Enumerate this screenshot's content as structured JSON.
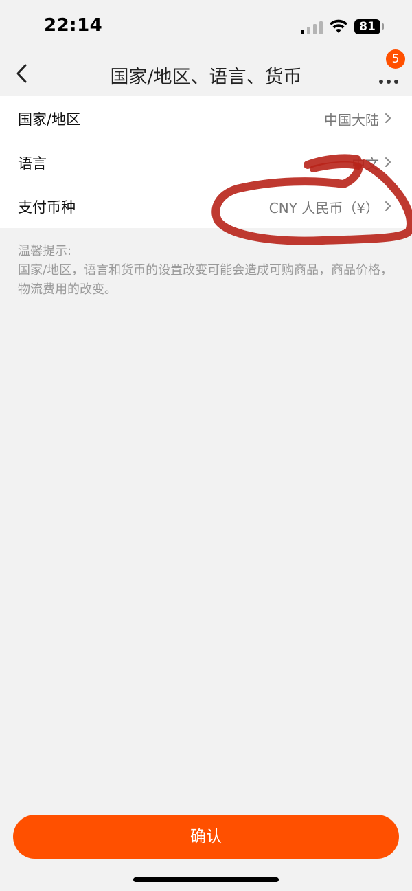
{
  "status_bar": {
    "time": "22:14",
    "battery": "81"
  },
  "nav": {
    "title": "国家/地区、语言、货币",
    "badge_count": "5",
    "icons": [
      "chevron-left-icon",
      "more-dots-icon"
    ]
  },
  "settings": {
    "rows": [
      {
        "label": "国家/地区",
        "value": "中国大陆"
      },
      {
        "label": "语言",
        "value": "中文"
      },
      {
        "label": "支付币种",
        "value": "CNY 人民币（¥）"
      }
    ]
  },
  "hint": {
    "title": "温馨提示:",
    "body": "国家/地区，语言和货币的设置改变可能会造成可购商品，商品价格，物流费用的改变。"
  },
  "confirm": {
    "label": "确认"
  },
  "colors": {
    "accent": "#ff5000",
    "background": "#f2f2f2",
    "annotation": "#b8231a"
  }
}
